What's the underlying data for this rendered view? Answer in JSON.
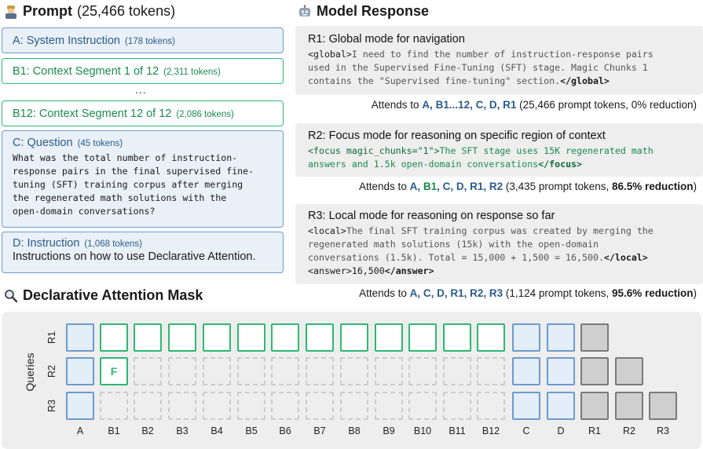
{
  "prompt": {
    "title": "Prompt",
    "tokens": "(25,466 tokens)",
    "ellipsis": "...",
    "boxes": [
      {
        "label": "A: System Instruction",
        "tokens": "(178 tokens)"
      },
      {
        "label": "B1: Context Segment 1 of 12",
        "tokens": "(2,311 tokens)"
      },
      {
        "label": "B12: Context Segment 12 of 12",
        "tokens": "(2,086 tokens)"
      },
      {
        "label": "C: Question",
        "tokens": "(45 tokens)",
        "lines": [
          "What was the total number of instruction-",
          "response pairs in the final supervised fine-",
          "tuning (SFT) training corpus after merging",
          "the regenerated math solutions with the",
          "open-domain conversations?"
        ]
      },
      {
        "label": "D: Instruction",
        "tokens": "(1,068 tokens)",
        "text": "Instructions on how to  use Declarative Attention."
      }
    ]
  },
  "response": {
    "title": "Model Response",
    "r1": {
      "title": "R1: Global mode for navigation",
      "open_tag": "<global>",
      "line1": "I need to find the number of instruction-response pairs",
      "line2": "used in the Supervised Fine-Tuning (SFT) stage. Magic Chunks 1",
      "line3": "contains the \"Supervised fine-tuning\" section.",
      "close_tag": "</global>",
      "attends_prefix": "Attends to ",
      "attends_a": "A, B1...12, C, D, R1",
      "attends_suffix": " (25,466 prompt tokens, 0% reduction)"
    },
    "r2": {
      "title": "R2: Focus mode for reasoning on specific region of context",
      "open_tag": "<focus magic_chunks=\"1\">",
      "line1": "The SFT stage uses 15K regenerated math",
      "line2": "answers and 1.5k open-domain conversations",
      "close_tag": "</focus>",
      "attends_prefix": "Attends to ",
      "attends_a": "A, ",
      "attends_b1": "B1",
      "attends_b": ", C, D, R1, R2",
      "attends_mid": " (3,435 prompt tokens, ",
      "attends_red": "86.5% reduction",
      "attends_end": ")"
    },
    "r3": {
      "title": "R3: Local mode for reasoning on response so far",
      "open_tag": "<local>",
      "line1": "The final SFT training corpus was created by merging the",
      "line2": "regenerated math solutions (15k) with the open-domain",
      "line3": "conversations (1.5k). Total = 15,000 + 1,500 = 16,500.",
      "close_tag": "</local>",
      "ans_open": "<answer>",
      "ans_val": "16,500",
      "ans_close": "</answer>",
      "attends_prefix": "Attends to ",
      "attends_a": "A, C, D, R1, R2, R3",
      "attends_mid": " (1,124 prompt tokens, ",
      "attends_red": "95.6% reduction",
      "attends_end": ")"
    }
  },
  "mask": {
    "title": "Declarative Attention Mask",
    "y_label": "Queries",
    "rows": [
      "R1",
      "R2",
      "R3"
    ],
    "cols": [
      "A",
      "B1",
      "B2",
      "B3",
      "B4",
      "B5",
      "B6",
      "B7",
      "B8",
      "B9",
      "B10",
      "B11",
      "B12",
      "C",
      "D",
      "R1",
      "R2",
      "R3"
    ],
    "focus_label": "F",
    "grid": [
      [
        "blue",
        "green",
        "green",
        "green",
        "green",
        "green",
        "green",
        "green",
        "green",
        "green",
        "green",
        "green",
        "green",
        "blue",
        "blue",
        "gray",
        "none",
        "none"
      ],
      [
        "blue",
        "green-f",
        "empty",
        "empty",
        "empty",
        "empty",
        "empty",
        "empty",
        "empty",
        "empty",
        "empty",
        "empty",
        "empty",
        "blue",
        "blue",
        "gray",
        "gray",
        "none"
      ],
      [
        "blue",
        "empty",
        "empty",
        "empty",
        "empty",
        "empty",
        "empty",
        "empty",
        "empty",
        "empty",
        "empty",
        "empty",
        "empty",
        "blue",
        "blue",
        "gray",
        "gray",
        "gray"
      ]
    ]
  },
  "colors": {
    "blue": "#6b9bd1",
    "green": "#2eb872",
    "gray": "#7a7a7a",
    "panel": "#eeeeee"
  }
}
